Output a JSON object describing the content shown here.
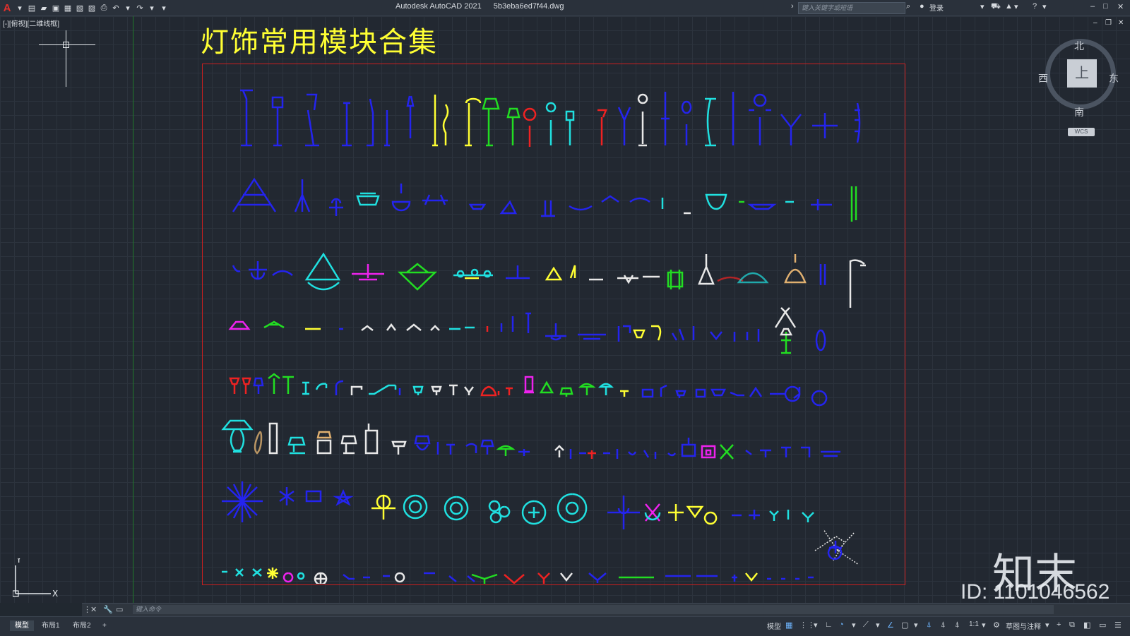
{
  "titlebar": {
    "app_name": "Autodesk AutoCAD 2021",
    "file_name": "5b3eba6ed7f44.dwg",
    "search_placeholder": "键入关键字或短语",
    "login_label": "登录"
  },
  "viewport": {
    "view_label": "[-][俯视][二维线框]",
    "drawing_title": "灯饰常用模块合集",
    "viewcube": {
      "north": "北",
      "south": "南",
      "east": "东",
      "west": "西",
      "top_face": "上",
      "wcs_label": "WCS"
    },
    "ucs": {
      "x_label": "X",
      "y_label": "Y"
    }
  },
  "watermark": {
    "logo": "知末",
    "id_text": "ID: 1101046562"
  },
  "command": {
    "placeholder": "键入命令"
  },
  "statusbar": {
    "tabs": [
      "模型",
      "布局1",
      "布局2"
    ],
    "add_tab": "+",
    "model_label": "模型",
    "scale_label": "1:1",
    "workspace_label": "草图与注释"
  },
  "colors": {
    "background": "#222831",
    "frame": "#cc1f1f",
    "title": "#ffff33",
    "blue": "#2020e6",
    "cyan": "#20e0e0",
    "yellow": "#ffff33",
    "green": "#22dd22",
    "magenta": "#ee22ee",
    "red": "#ee2222",
    "white": "#e8e8e8",
    "orange": "#e0b070"
  }
}
